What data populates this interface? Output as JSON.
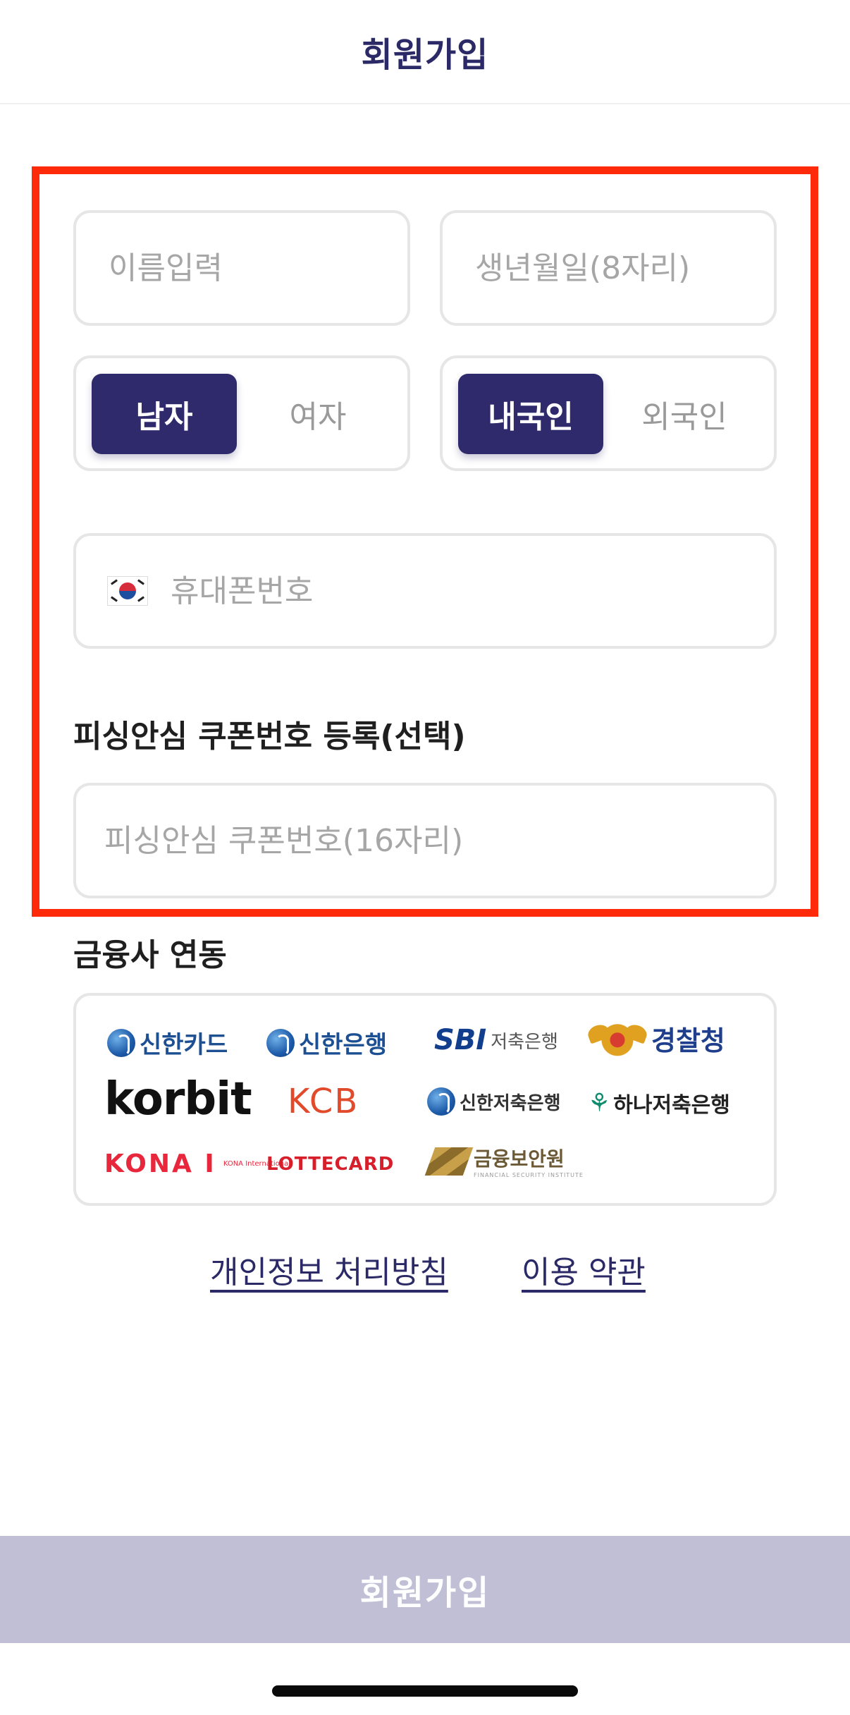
{
  "header": {
    "title": "회원가입"
  },
  "form": {
    "name_placeholder": "이름입력",
    "birth_placeholder": "생년월일(8자리)",
    "gender": {
      "options": [
        "남자",
        "여자"
      ],
      "selected": "남자"
    },
    "nationality": {
      "options": [
        "내국인",
        "외국인"
      ],
      "selected": "내국인"
    },
    "phone_placeholder": "휴대폰번호",
    "coupon_label": "피싱안심 쿠폰번호 등록(선택)",
    "coupon_placeholder": "피싱안심 쿠폰번호(16자리)"
  },
  "partners": {
    "label": "금융사 연동",
    "logos": {
      "shinhan_card": "신한카드",
      "shinhan_bank": "신한은행",
      "sbi_mark": "SBI",
      "sbi_sub": "저축은행",
      "police": "경찰청",
      "korbit": "korbit",
      "kcb": "KCB",
      "shinhan_savings": "신한저축은행",
      "hana_savings": "하나저축은행",
      "kona": "KONA I",
      "kona_sub": "KONA International",
      "lotte": "LOTTE",
      "lotte_card": "CARD",
      "fsi": "금융보안원",
      "fsi_sub": "FINANCIAL SECURITY INSTITUTE"
    }
  },
  "links": {
    "privacy": "개인정보 처리방침",
    "terms": "이용 약관"
  },
  "submit": {
    "label": "회원가입"
  },
  "colors": {
    "primary": "#2f2a6b",
    "highlight": "#ff2a0a",
    "submit_disabled": "#c1bfd5"
  }
}
